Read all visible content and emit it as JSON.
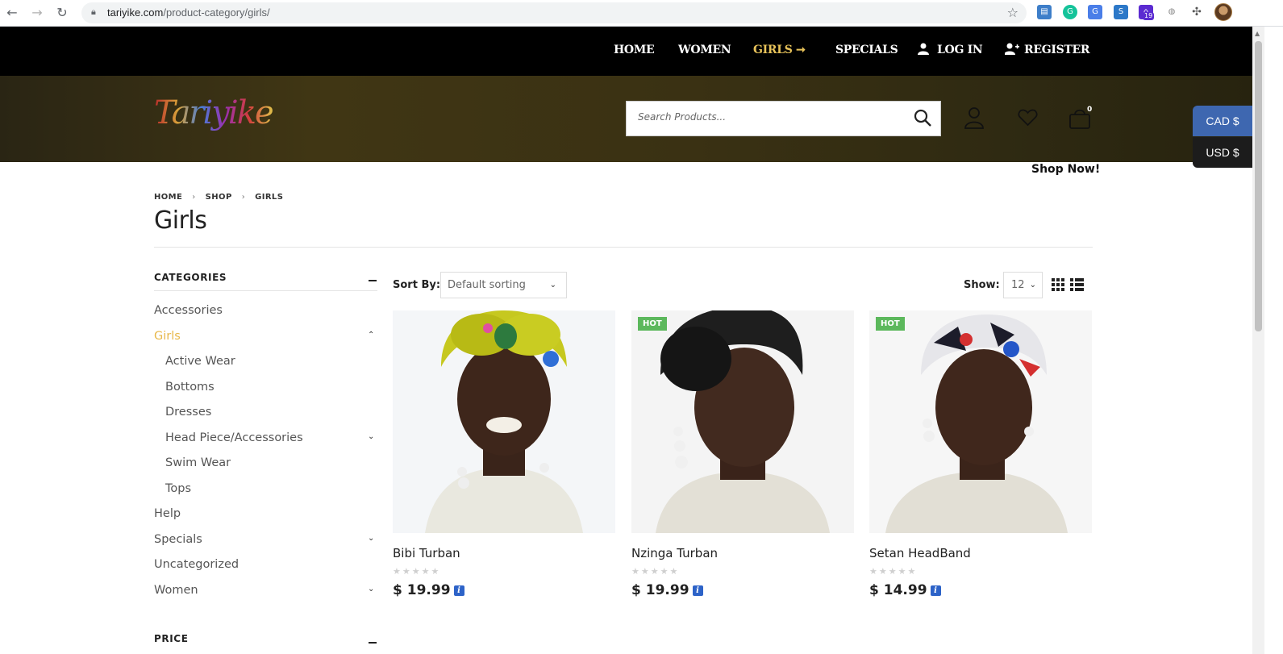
{
  "browser": {
    "url_domain": "tariyike.com",
    "url_path": "/product-category/girls/",
    "extension_badge": "19"
  },
  "nav": {
    "items": [
      {
        "label": "HOME"
      },
      {
        "label": "WOMEN"
      },
      {
        "label": "GIRLS ➞"
      },
      {
        "label": "SPECIALS"
      },
      {
        "label": "LOG IN"
      },
      {
        "label": "REGISTER"
      }
    ]
  },
  "header": {
    "logo_text": "Tariyike",
    "search_placeholder": "Search Products...",
    "cart_count": "0"
  },
  "currency": {
    "cad": "CAD $",
    "usd": "USD $"
  },
  "promo": "Shop Now!",
  "breadcrumb": [
    "HOME",
    "SHOP",
    "GIRLS"
  ],
  "page_title": "Girls",
  "sidebar": {
    "categories_title": "CATEGORIES",
    "items": [
      {
        "label": "Accessories"
      },
      {
        "label": "Girls"
      },
      {
        "label": "Active Wear"
      },
      {
        "label": "Bottoms"
      },
      {
        "label": "Dresses"
      },
      {
        "label": "Head Piece/Accessories"
      },
      {
        "label": "Swim Wear"
      },
      {
        "label": "Tops"
      },
      {
        "label": "Help"
      },
      {
        "label": "Specials"
      },
      {
        "label": "Uncategorized"
      },
      {
        "label": "Women"
      }
    ],
    "price_title": "PRICE"
  },
  "toolbar": {
    "sort_label": "Sort By:",
    "sort_value": "Default sorting",
    "show_label": "Show:",
    "show_value": "12"
  },
  "products": [
    {
      "name": "Bibi Turban",
      "price": "$ 19.99",
      "badge": "",
      "wrap_color": "#c6c81f"
    },
    {
      "name": "Nzinga Turban",
      "price": "$ 19.99",
      "badge": "HOT",
      "wrap_color": "#1e1e1e"
    },
    {
      "name": "Setan HeadBand",
      "price": "$ 14.99",
      "badge": "HOT",
      "wrap_color": "#e6e6ea"
    }
  ],
  "colors": {
    "accent": "#e8b84a",
    "hot_badge": "#5cb85c",
    "cad_button": "#3e67b0"
  }
}
